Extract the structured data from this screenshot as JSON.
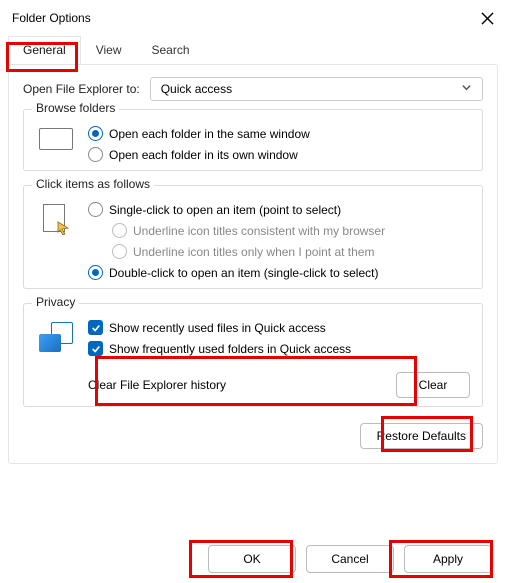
{
  "title": "Folder Options",
  "tabs": {
    "general": "General",
    "view": "View",
    "search": "Search"
  },
  "open_to": {
    "label": "Open File Explorer to:",
    "value": "Quick access"
  },
  "browse": {
    "legend": "Browse folders",
    "same": "Open each folder in the same window",
    "own": "Open each folder in its own window"
  },
  "click": {
    "legend": "Click items as follows",
    "single": "Single-click to open an item (point to select)",
    "u_browser": "Underline icon titles consistent with my browser",
    "u_point": "Underline icon titles only when I point at them",
    "double": "Double-click to open an item (single-click to select)"
  },
  "privacy": {
    "legend": "Privacy",
    "recent": "Show recently used files in Quick access",
    "frequent": "Show frequently used folders in Quick access",
    "clear_label": "Clear File Explorer history",
    "clear_btn": "Clear"
  },
  "restore": "Restore Defaults",
  "actions": {
    "ok": "OK",
    "cancel": "Cancel",
    "apply": "Apply"
  }
}
